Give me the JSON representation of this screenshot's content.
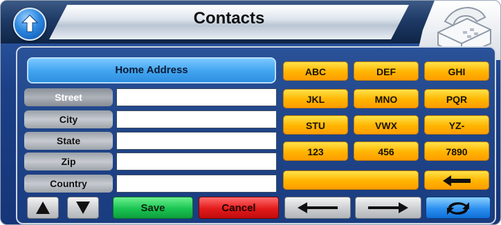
{
  "header": {
    "title": "Contacts"
  },
  "form": {
    "section_title": "Home Address",
    "fields": [
      {
        "label": "Street",
        "value": ""
      },
      {
        "label": "City",
        "value": ""
      },
      {
        "label": "State",
        "value": ""
      },
      {
        "label": "Zip",
        "value": ""
      },
      {
        "label": "Country",
        "value": ""
      }
    ]
  },
  "keypad": {
    "keys": [
      "ABC",
      "DEF",
      "GHI",
      "JKL",
      "MNO",
      "PQR",
      "STU",
      "VWX",
      "YZ-",
      "123",
      "456",
      "7890"
    ],
    "space_label": "",
    "backspace_icon": "backspace-arrow-icon"
  },
  "bottom_bar": {
    "up_icon": "triangle-up-icon",
    "down_icon": "triangle-down-icon",
    "save_label": "Save",
    "cancel_label": "Cancel",
    "left_icon": "arrow-left-icon",
    "right_icon": "arrow-right-icon",
    "refresh_icon": "refresh-icon"
  },
  "colors": {
    "key_yellow": "#ffb400",
    "save_green": "#19c452",
    "cancel_red": "#e31a1a",
    "panel_blue": "#1f4488"
  }
}
